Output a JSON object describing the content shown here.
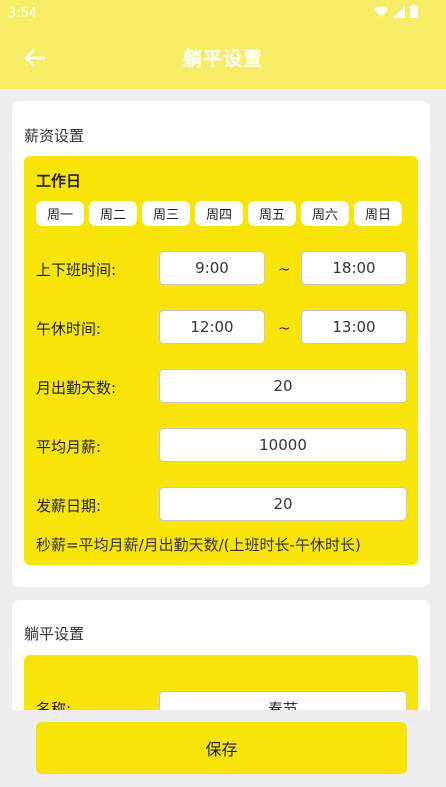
{
  "status_bar": {
    "time": "3:54"
  },
  "app_bar": {
    "title": "躺平设置"
  },
  "salary_card": {
    "title": "薪资设置",
    "workdays_title": "工作日",
    "days": [
      "周一",
      "周二",
      "周三",
      "周四",
      "周五",
      "周六",
      "周日"
    ],
    "work_hours": {
      "label": "上下班时间:",
      "start": "9:00",
      "end": "18:00"
    },
    "lunch_break": {
      "label": "午休时间:",
      "start": "12:00",
      "end": "13:00"
    },
    "separator": "~",
    "attendance_days": {
      "label": "月出勤天数:",
      "value": "20"
    },
    "avg_salary": {
      "label": "平均月薪:",
      "value": "10000"
    },
    "pay_day": {
      "label": "发薪日期:",
      "value": "20"
    },
    "formula": "秒薪=平均月薪/月出勤天数/(上班时长-午休时长)"
  },
  "lie_flat_card": {
    "title": "躺平设置",
    "name": {
      "label": "名称:",
      "value": "春节"
    }
  },
  "save_button": {
    "label": "保存"
  },
  "colors": {
    "header": "#f6ec66",
    "panel": "#f9e40a",
    "background": "#eeeeee"
  }
}
